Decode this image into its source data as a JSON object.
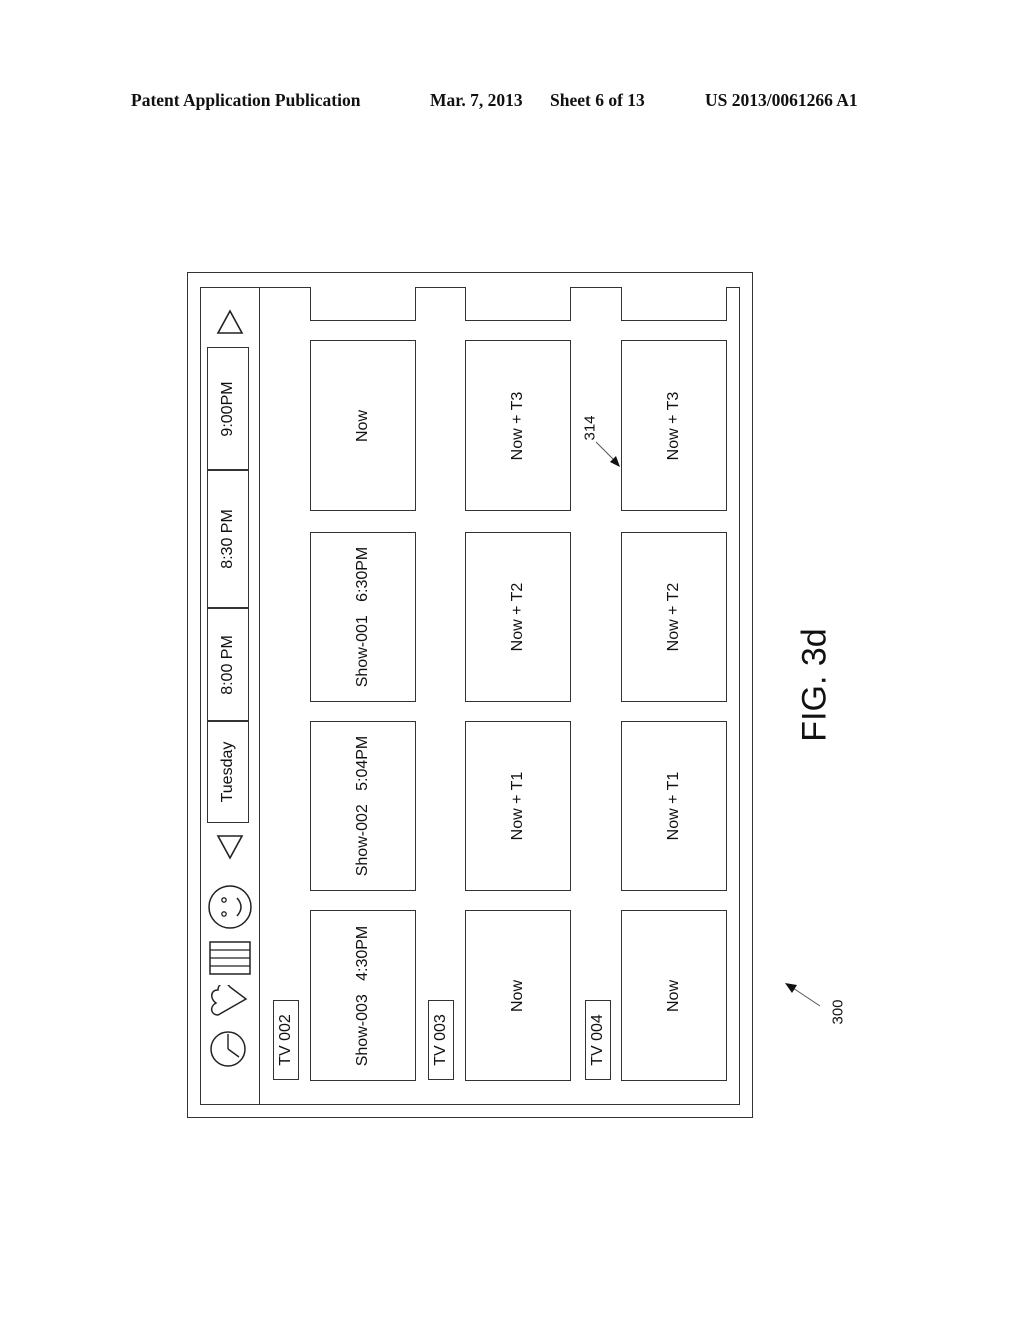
{
  "header": {
    "publication_type": "Patent Application Publication",
    "date": "Mar. 7, 2013",
    "sheet": "Sheet 6 of 13",
    "patent_number": "US 2013/0061266 A1"
  },
  "figure": {
    "label": "FIG. 3d",
    "device_ref": "300",
    "cell_ref": "314",
    "orientation": "rotated 90° counter-clockwise"
  },
  "toolbar": {
    "icons": [
      "clock-icon",
      "heart-icon",
      "grid-icon",
      "smiley-icon",
      "triangle-left-icon",
      "triangle-right-icon"
    ],
    "day_label": "Tuesday",
    "time_slots": [
      "8:00 PM",
      "8:30 PM",
      "9:00PM"
    ]
  },
  "channels": [
    {
      "name": "TV 002",
      "cells": [
        "Show-003   4:30PM",
        "Show-002   5:04PM",
        "Show-001   6:30PM",
        "Now",
        ""
      ]
    },
    {
      "name": "TV 003",
      "cells": [
        "Now",
        "Now + T1",
        "Now + T2",
        "Now + T3",
        ""
      ]
    },
    {
      "name": "TV 004",
      "cells": [
        "Now",
        "Now + T1",
        "Now + T2",
        "Now + T3",
        ""
      ]
    }
  ]
}
